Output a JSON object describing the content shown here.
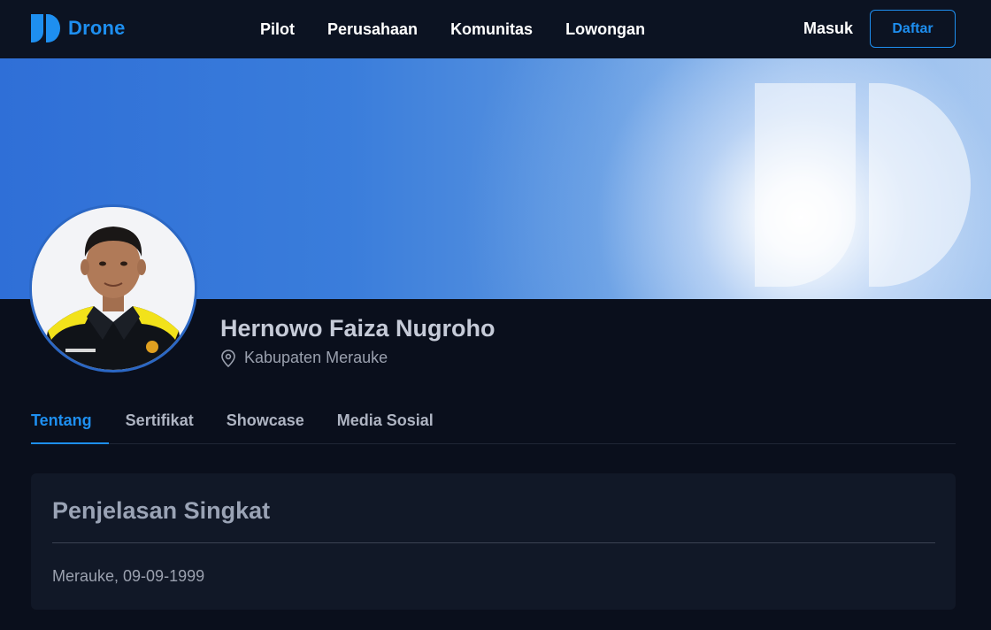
{
  "navbar": {
    "brand": "Drone",
    "links": [
      "Pilot",
      "Perusahaan",
      "Komunitas",
      "Lowongan"
    ],
    "login_label": "Masuk",
    "register_label": "Daftar"
  },
  "profile": {
    "name": "Hernowo Faiza Nugroho",
    "location": "Kabupaten Merauke"
  },
  "tabs": {
    "items": [
      "Tentang",
      "Sertifikat",
      "Showcase",
      "Media Sosial"
    ],
    "active": "Tentang"
  },
  "about_card": {
    "title": "Penjelasan Singkat",
    "text": "Merauke, 09-09-1999"
  },
  "icons": {
    "brand": "drone-logo-icon",
    "location": "map-pin-icon"
  },
  "colors": {
    "accent": "#1e8ff0",
    "background": "#0a0f1c",
    "navbar": "#0c1322",
    "card": "#111827"
  }
}
